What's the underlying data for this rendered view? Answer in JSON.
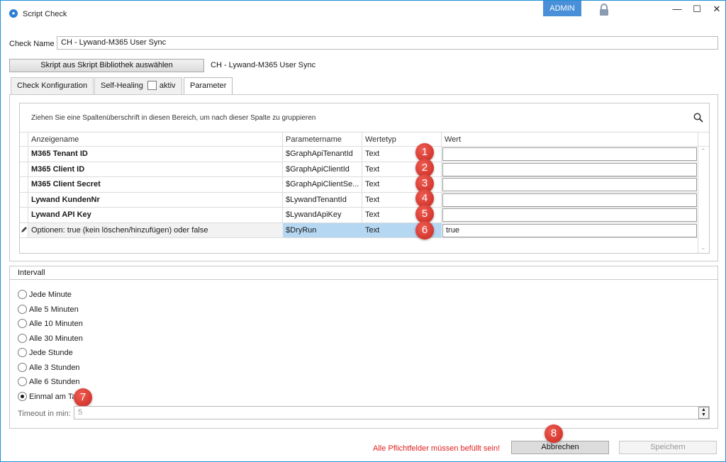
{
  "window": {
    "title": "Script Check",
    "admin_label": "ADMIN",
    "controls": {
      "minimize": "—",
      "maximize": "☐",
      "close": "✕"
    }
  },
  "check_name": {
    "label": "Check Name",
    "value": "CH - Lywand-M365 User Sync"
  },
  "script_select": {
    "button_label": "Skript aus Skript Bibliothek auswählen",
    "selected_script": "CH - Lywand-M365 User Sync"
  },
  "tabs": [
    {
      "label": "Check Konfiguration"
    },
    {
      "label": "Self-Healing",
      "checkbox_label": "aktiv",
      "checked": false
    },
    {
      "label": "Parameter",
      "active": true
    }
  ],
  "grid": {
    "group_hint": "Ziehen Sie eine Spaltenüberschrift in diesen Bereich, um nach dieser Spalte zu gruppieren",
    "columns": [
      "Anzeigename",
      "Parametername",
      "Wertetyp",
      "Wert"
    ],
    "rows": [
      {
        "display_name": "M365 Tenant ID",
        "param_name": "$GraphApiTenantId",
        "type": "Text",
        "value": "",
        "badge": "1",
        "required": true
      },
      {
        "display_name": "M365 Client ID",
        "param_name": "$GraphApiClientId",
        "type": "Text",
        "value": "",
        "badge": "2",
        "required": true
      },
      {
        "display_name": "M365 Client Secret",
        "param_name": "$GraphApiClientSe...",
        "type": "Text",
        "value": "",
        "badge": "3",
        "required": true
      },
      {
        "display_name": "Lywand KundenNr",
        "param_name": "$LywandTenantId",
        "type": "Text",
        "value": "",
        "badge": "4",
        "required": true
      },
      {
        "display_name": "Lywand API Key",
        "param_name": "$LywandApiKey",
        "type": "Text",
        "value": "",
        "badge": "5",
        "required": true
      },
      {
        "display_name": "Optionen: true (kein löschen/hinzufügen) oder false",
        "param_name": "$DryRun",
        "type": "Text",
        "value": "true",
        "badge": "6",
        "required": false,
        "selected": true
      }
    ]
  },
  "interval": {
    "title": "Intervall",
    "options": [
      {
        "label": "Jede Minute",
        "selected": false
      },
      {
        "label": "Alle 5 Minuten",
        "selected": false
      },
      {
        "label": "Alle 10 Minuten",
        "selected": false
      },
      {
        "label": "Alle 30 Minuten",
        "selected": false
      },
      {
        "label": "Jede Stunde",
        "selected": false
      },
      {
        "label": "Alle 3 Stunden",
        "selected": false
      },
      {
        "label": "Alle 6 Stunden",
        "selected": false
      },
      {
        "label": "Einmal am Tag",
        "selected": true
      }
    ],
    "badge": "7",
    "timeout_label": "Timeout in min:",
    "timeout_value": "5"
  },
  "footer": {
    "error_message": "Alle Pflichtfelder müssen befüllt sein!",
    "cancel_label": "Abbrechen",
    "save_label": "Speichern",
    "badge": "8"
  },
  "colors": {
    "accent": "#1e90d8",
    "admin_badge": "#4a90d9",
    "error": "#e02020",
    "selected_row": "#b6d7f2",
    "badge": "#d9342b"
  }
}
